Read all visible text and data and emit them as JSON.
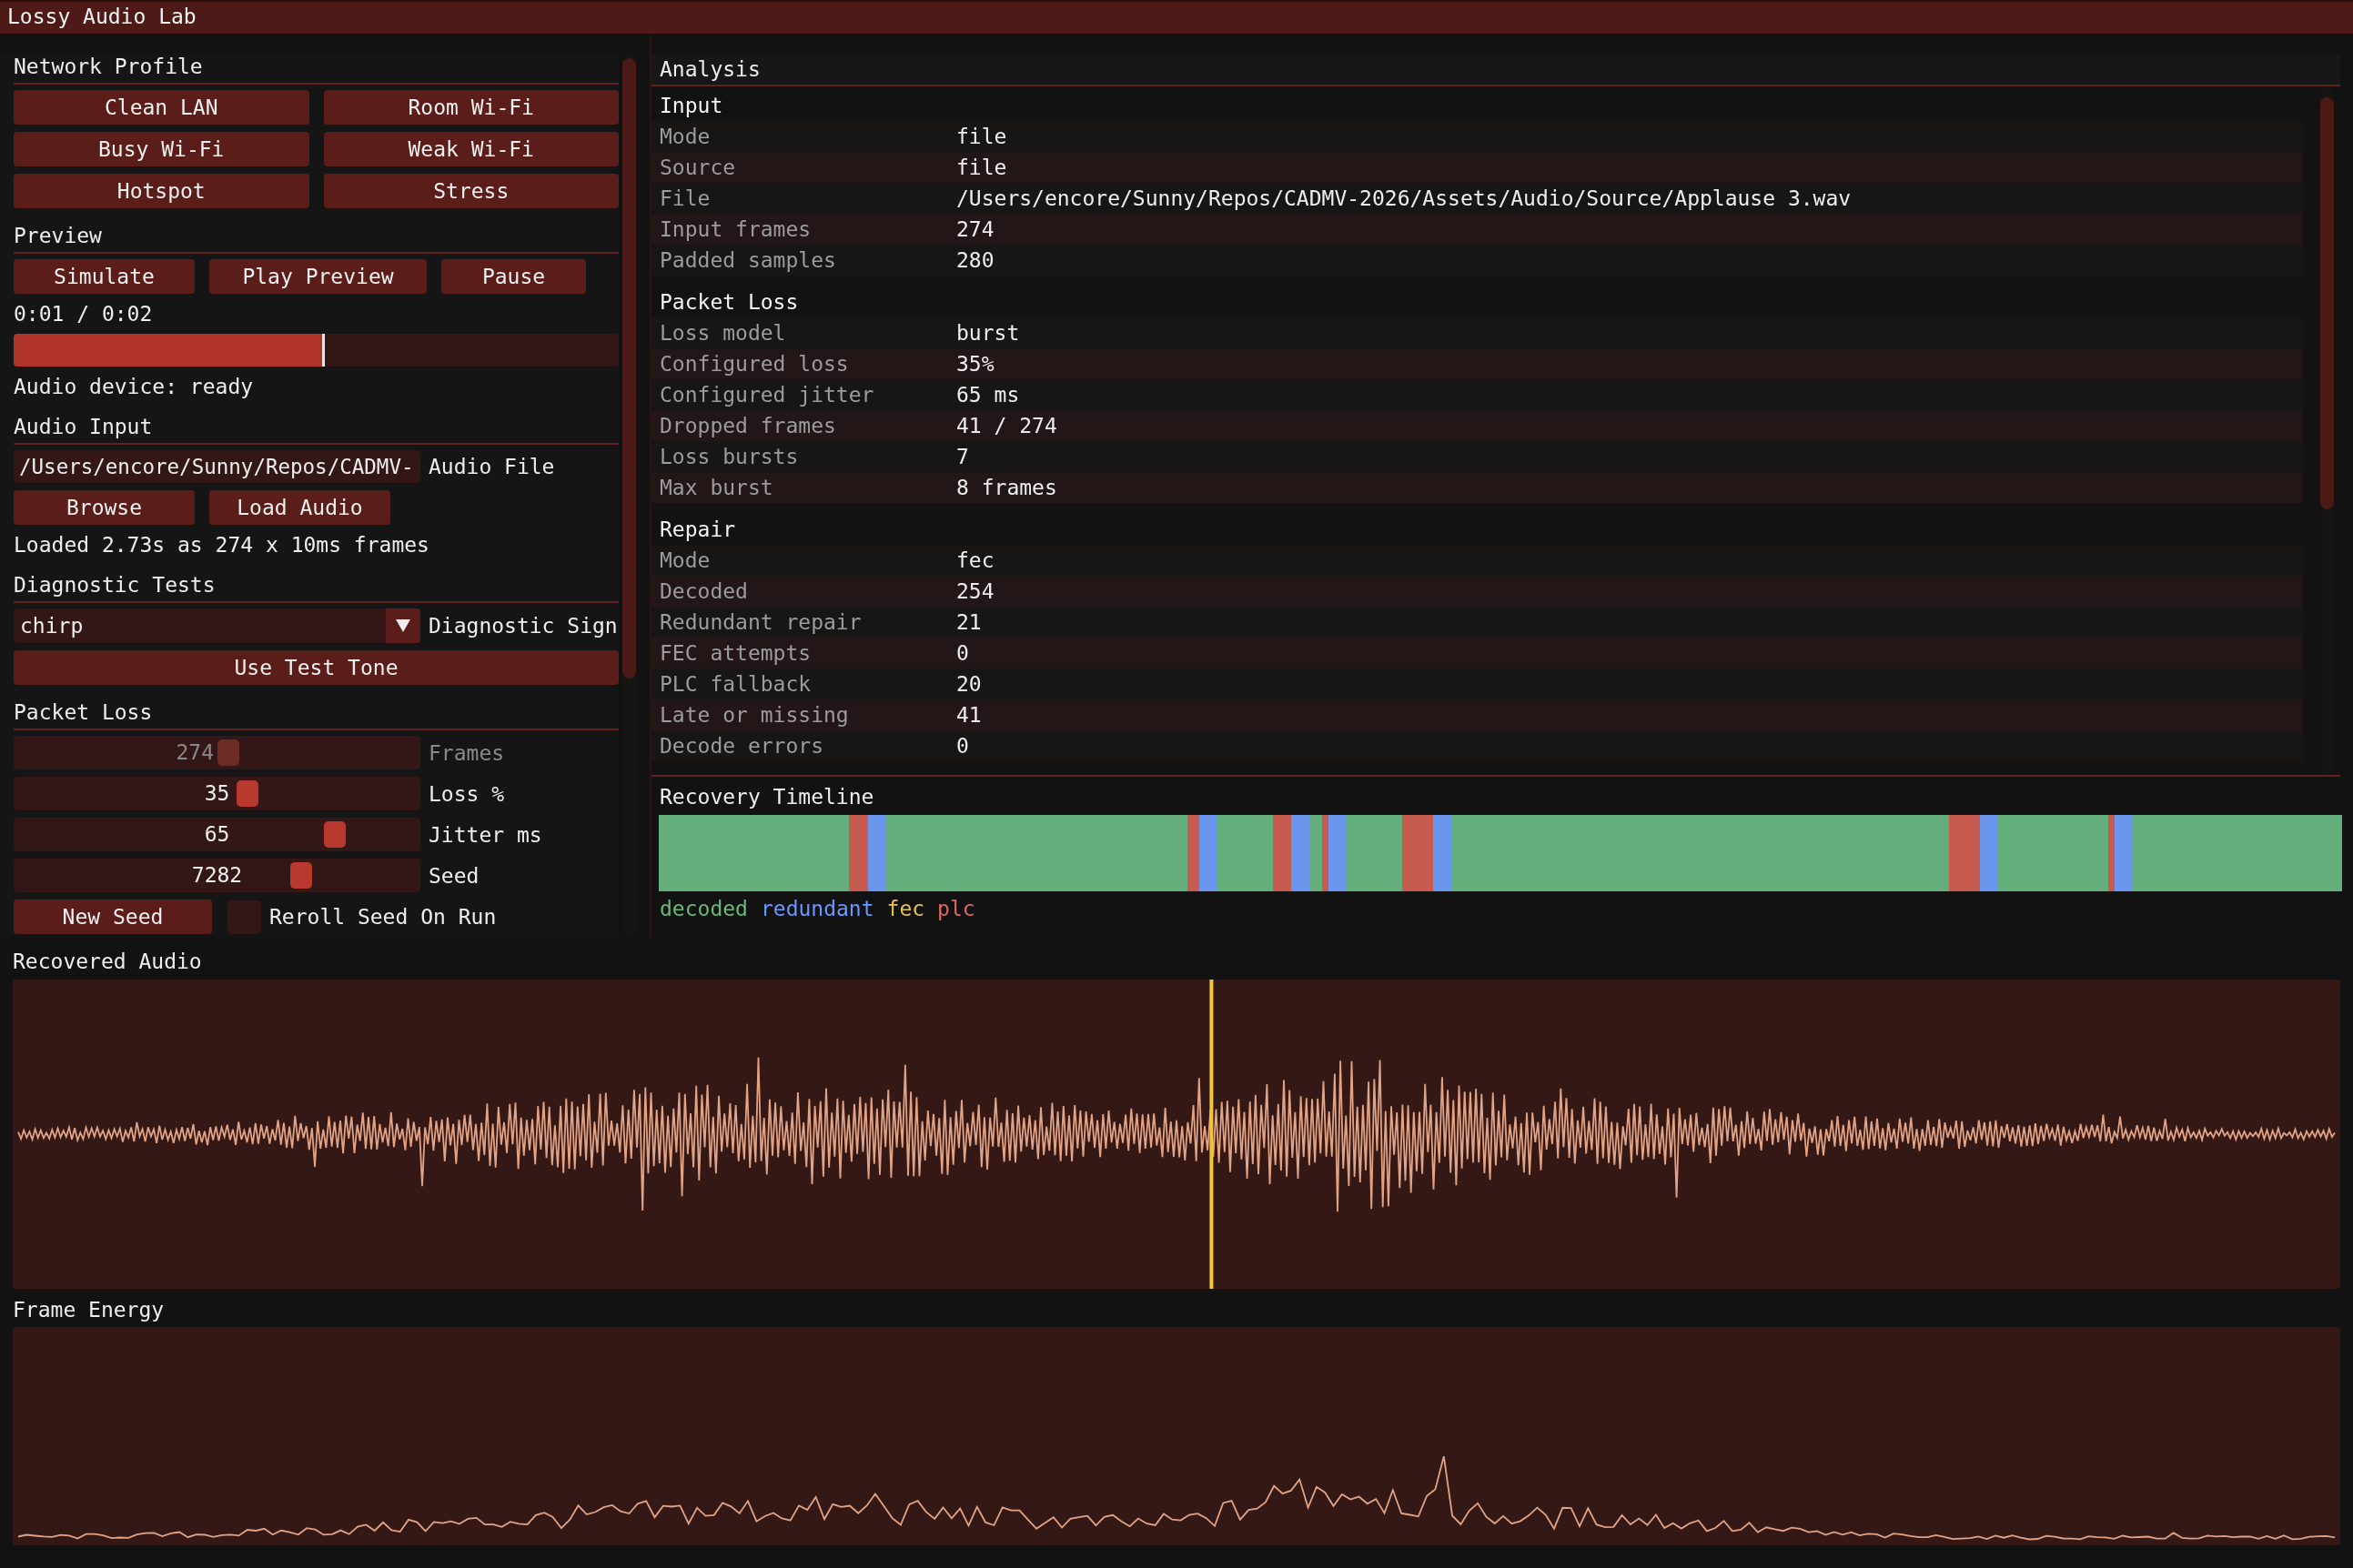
{
  "window": {
    "title": "Lossy Audio Lab"
  },
  "network_profile": {
    "title": "Network Profile",
    "buttons": [
      "Clean LAN",
      "Room Wi-Fi",
      "Busy Wi-Fi",
      "Weak Wi-Fi",
      "Hotspot",
      "Stress"
    ]
  },
  "preview": {
    "title": "Preview",
    "buttons": [
      "Simulate",
      "Play Preview",
      "Pause"
    ],
    "time": "0:01 / 0:02",
    "level": 0.515,
    "device_status": "Audio device: ready"
  },
  "audio_input": {
    "title": "Audio Input",
    "file_path": {
      "value": "/Users/encore/Sunny/Repos/CADMV-",
      "label": "Audio File"
    },
    "buttons": [
      "Browse",
      "Load Audio"
    ],
    "status": "Loaded 2.73s as 274 x 10ms frames"
  },
  "diagnostic_tests": {
    "title": "Diagnostic Tests",
    "signal": {
      "value": "chirp",
      "label": "Diagnostic Sign"
    },
    "button": "Use Test Tone"
  },
  "packet_loss": {
    "title": "Packet Loss",
    "sliders": [
      {
        "label": "Frames",
        "value": "274",
        "level": 0.53,
        "disabled": true
      },
      {
        "label": "Loss %",
        "value": "35",
        "level": 0.58,
        "disabled": false
      },
      {
        "label": "Jitter ms",
        "value": "65",
        "level": 0.81,
        "disabled": false
      },
      {
        "label": "Seed",
        "value": "7282",
        "level": 0.72,
        "disabled": false
      }
    ],
    "new_seed_button": "New Seed",
    "reroll_on_run": {
      "label": "Reroll Seed On Run",
      "checked": false
    }
  },
  "analysis": {
    "title": "Analysis",
    "sections": [
      {
        "title": "Input",
        "rows": [
          {
            "label": "Mode",
            "value": "file"
          },
          {
            "label": "Source",
            "value": "file"
          },
          {
            "label": "File",
            "value": "/Users/encore/Sunny/Repos/CADMV-2026/Assets/Audio/Source/Applause 3.wav"
          },
          {
            "label": "Input frames",
            "value": "274"
          },
          {
            "label": "Padded samples",
            "value": "280"
          }
        ]
      },
      {
        "title": "Packet Loss",
        "rows": [
          {
            "label": "Loss model",
            "value": "burst"
          },
          {
            "label": "Configured loss",
            "value": "35%"
          },
          {
            "label": "Configured jitter",
            "value": "65 ms"
          },
          {
            "label": "Dropped frames",
            "value": "41 / 274"
          },
          {
            "label": "Loss bursts",
            "value": "7"
          },
          {
            "label": "Max burst",
            "value": "8 frames"
          }
        ]
      },
      {
        "title": "Repair",
        "rows": [
          {
            "label": "Mode",
            "value": "fec"
          },
          {
            "label": "Decoded",
            "value": "254"
          },
          {
            "label": "Redundant repair",
            "value": "21"
          },
          {
            "label": "FEC attempts",
            "value": "0"
          },
          {
            "label": "PLC fallback",
            "value": "20"
          },
          {
            "label": "Late or missing",
            "value": "41"
          },
          {
            "label": "Decode errors",
            "value": "0"
          }
        ]
      }
    ]
  },
  "recovery_timeline": {
    "title": "Recovery Timeline",
    "legend": [
      {
        "label": "decoded",
        "color": "#66bb77"
      },
      {
        "label": "redundant",
        "color": "#6699ff"
      },
      {
        "label": "fec",
        "color": "#e6c24d"
      },
      {
        "label": "plc",
        "color": "#e06666"
      }
    ]
  },
  "recovered_audio": {
    "title": "Recovered Audio"
  },
  "frame_energy": {
    "title": "Frame Energy"
  }
}
